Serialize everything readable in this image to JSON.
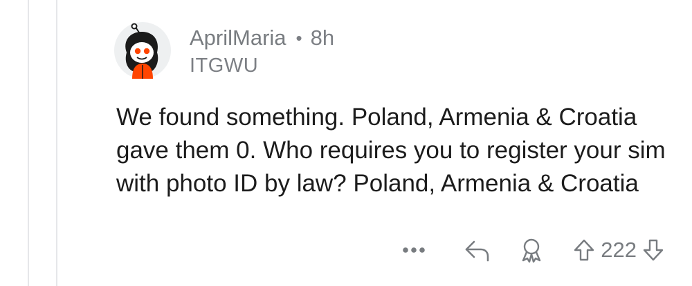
{
  "comment": {
    "username": "AprilMaria",
    "separator": "•",
    "time_ago": "8h",
    "flair": "ITGWU",
    "body": "We found something. Poland, Armenia & Croatia gave them 0. Who requires you to register your sim with photo ID by law? Poland, Armenia & Croatia",
    "vote_count": "222"
  },
  "icons": {
    "avatar": "snoo-avatar-icon",
    "more": "more-options-icon",
    "reply": "reply-arrow-icon",
    "award": "award-icon",
    "upvote": "upvote-arrow-icon",
    "downvote": "downvote-arrow-icon"
  },
  "colors": {
    "text": "#1c1c1c",
    "meta": "#787c80",
    "thread_line": "#e6e7e9",
    "avatar_accent": "#ff4500"
  }
}
